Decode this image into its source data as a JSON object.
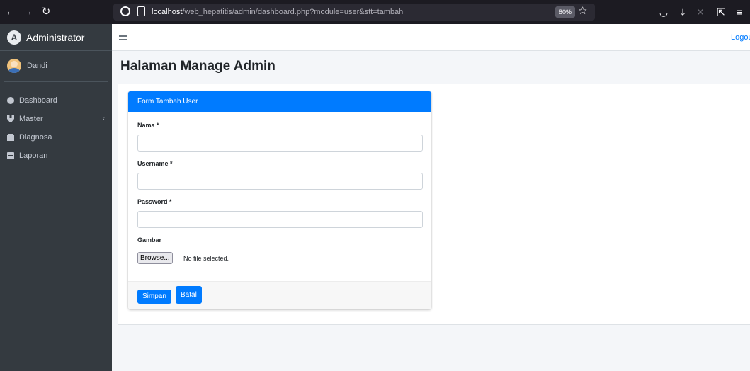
{
  "browser": {
    "url_host": "localhost",
    "url_path": "/web_hepatitis/admin/dashboard.php?module=user&stt=tambah",
    "zoom": "80%"
  },
  "sidebar": {
    "brand": "Administrator",
    "user": "Dandi",
    "items": [
      {
        "label": "Dashboard",
        "icon": "dashboard-icon"
      },
      {
        "label": "Master",
        "icon": "plug-icon",
        "caret": "‹"
      },
      {
        "label": "Diagnosa",
        "icon": "clipboard-icon"
      },
      {
        "label": "Laporan",
        "icon": "report-icon"
      }
    ]
  },
  "navbar": {
    "logout": "Logou"
  },
  "page": {
    "title": "Halaman Manage Admin"
  },
  "form": {
    "header": "Form Tambah User",
    "fields": {
      "nama": {
        "label": "Nama *",
        "value": ""
      },
      "username": {
        "label": "Username *",
        "value": ""
      },
      "password": {
        "label": "Password *",
        "value": ""
      },
      "gambar": {
        "label": "Gambar",
        "button": "Browse...",
        "status": "No file selected."
      }
    },
    "buttons": {
      "save": "Simpan",
      "cancel": "Batal"
    }
  },
  "colors": {
    "primary": "#007bff",
    "sidebar": "#343a40",
    "browser_chrome": "#1c1b22"
  }
}
